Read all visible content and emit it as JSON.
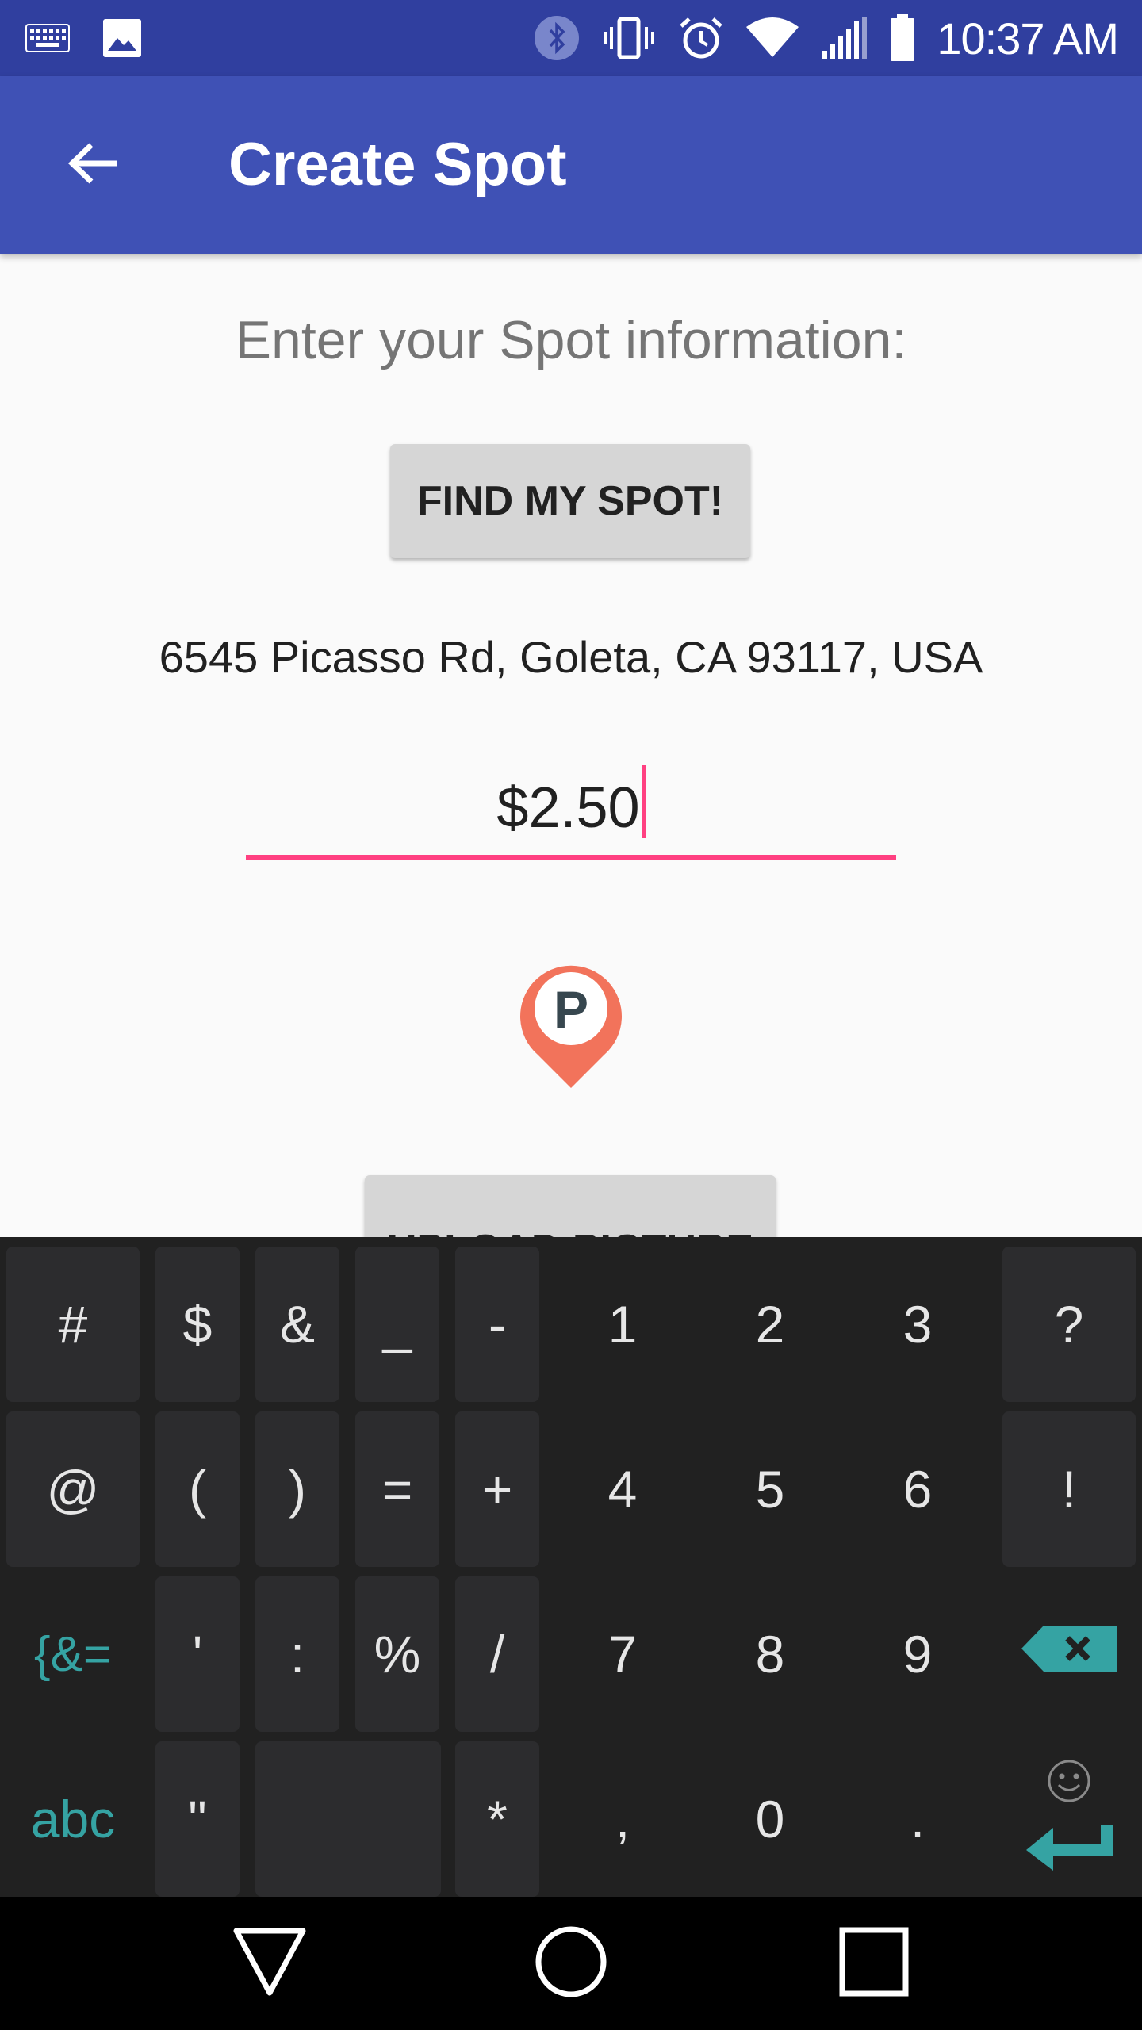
{
  "status_bar": {
    "time": "10:37 AM",
    "background": "#303f9f",
    "left_icons": [
      "keyboard-icon",
      "image-icon"
    ],
    "right_icons": [
      "bluetooth-icon",
      "vibrate-icon",
      "alarm-icon",
      "wifi-icon",
      "signal-icon",
      "battery-icon"
    ]
  },
  "app_bar": {
    "title": "Create Spot",
    "background": "#3f51b5",
    "back_icon": "arrow-back-icon"
  },
  "form": {
    "prompt": "Enter your Spot information:",
    "find_button": "FIND MY SPOT!",
    "address": "6545 Picasso Rd, Goleta, CA 93117, USA",
    "price_value": "$2.50",
    "accent_color": "#ff4081",
    "pin_icon": "parking-pin-icon",
    "pin_color": "#f2735b",
    "pin_letter": "P",
    "upload_button": "UPLOAD PICTURE"
  },
  "keyboard": {
    "accent_color": "#35a3a3",
    "rows": [
      [
        "#",
        "$",
        "&",
        "_",
        "-",
        "1",
        "2",
        "3",
        "?"
      ],
      [
        "@",
        "(",
        ")",
        "=",
        "+",
        "4",
        "5",
        "6",
        "!"
      ],
      [
        "{&=",
        "'",
        ":",
        "%",
        "/",
        "7",
        "8",
        "9",
        "⌫"
      ],
      [
        "abc",
        "\"",
        "",
        "*",
        ",",
        "0",
        ".",
        "↵"
      ]
    ]
  },
  "nav_bar": {
    "icons": [
      "back-triangle-icon",
      "home-circle-icon",
      "recents-square-icon"
    ]
  }
}
